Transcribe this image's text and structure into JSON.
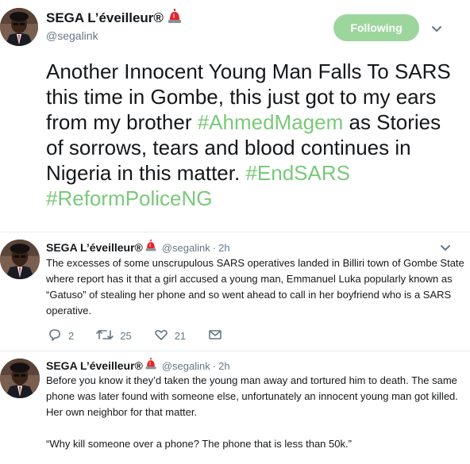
{
  "main_tweet": {
    "display_name": "SEGA L’éveilleur®",
    "handle": "@segalink",
    "follow_label": "Following",
    "text_parts": [
      {
        "text": "Another Innocent Young Man Falls To SARS this time in Gombe, this just got to my ears from my brother ",
        "hashtag": false
      },
      {
        "text": "#AhmedMagem",
        "hashtag": true
      },
      {
        "text": " as Stories of sorrows, tears and blood continues in Nigeria in this matter. ",
        "hashtag": false
      },
      {
        "text": "#EndSARS",
        "hashtag": true
      },
      {
        "text": " ",
        "hashtag": false
      },
      {
        "text": "#ReformPoliceNG",
        "hashtag": true
      }
    ]
  },
  "replies": [
    {
      "display_name": "SEGA L’éveilleur®",
      "handle": "@segalink",
      "separator": "·",
      "time": "2h",
      "text": "The excesses of some unscrupulous SARS operatives landed in Billiri town of Gombe State where report has it that a girl accused a young man, Emmanuel Luka popularly known as “Gatuso” of stealing her phone and so went ahead to call in her boyfriend who is a SARS operative.",
      "reply_count": "2",
      "retweet_count": "25",
      "like_count": "21"
    },
    {
      "display_name": "SEGA L’éveilleur®",
      "handle": "@segalink",
      "separator": "·",
      "time": "2h",
      "text": "Before you know it they’d taken the young man away and tortured him to death. The same phone was later found with someone else, unfortunately an innocent young man got killed. Her own neighbor for that matter.",
      "quote": "“Why kill someone over a phone? The phone that is less than 50k.”"
    }
  ],
  "colors": {
    "hashtag": "#79c979",
    "follow_button": "#9cd69c",
    "secondary_text": "#657786",
    "divider": "#e6ecf0"
  },
  "icons": [
    "police-siren-icon",
    "chevron-down-icon",
    "reply-icon",
    "retweet-icon",
    "like-icon",
    "direct-message-icon"
  ]
}
